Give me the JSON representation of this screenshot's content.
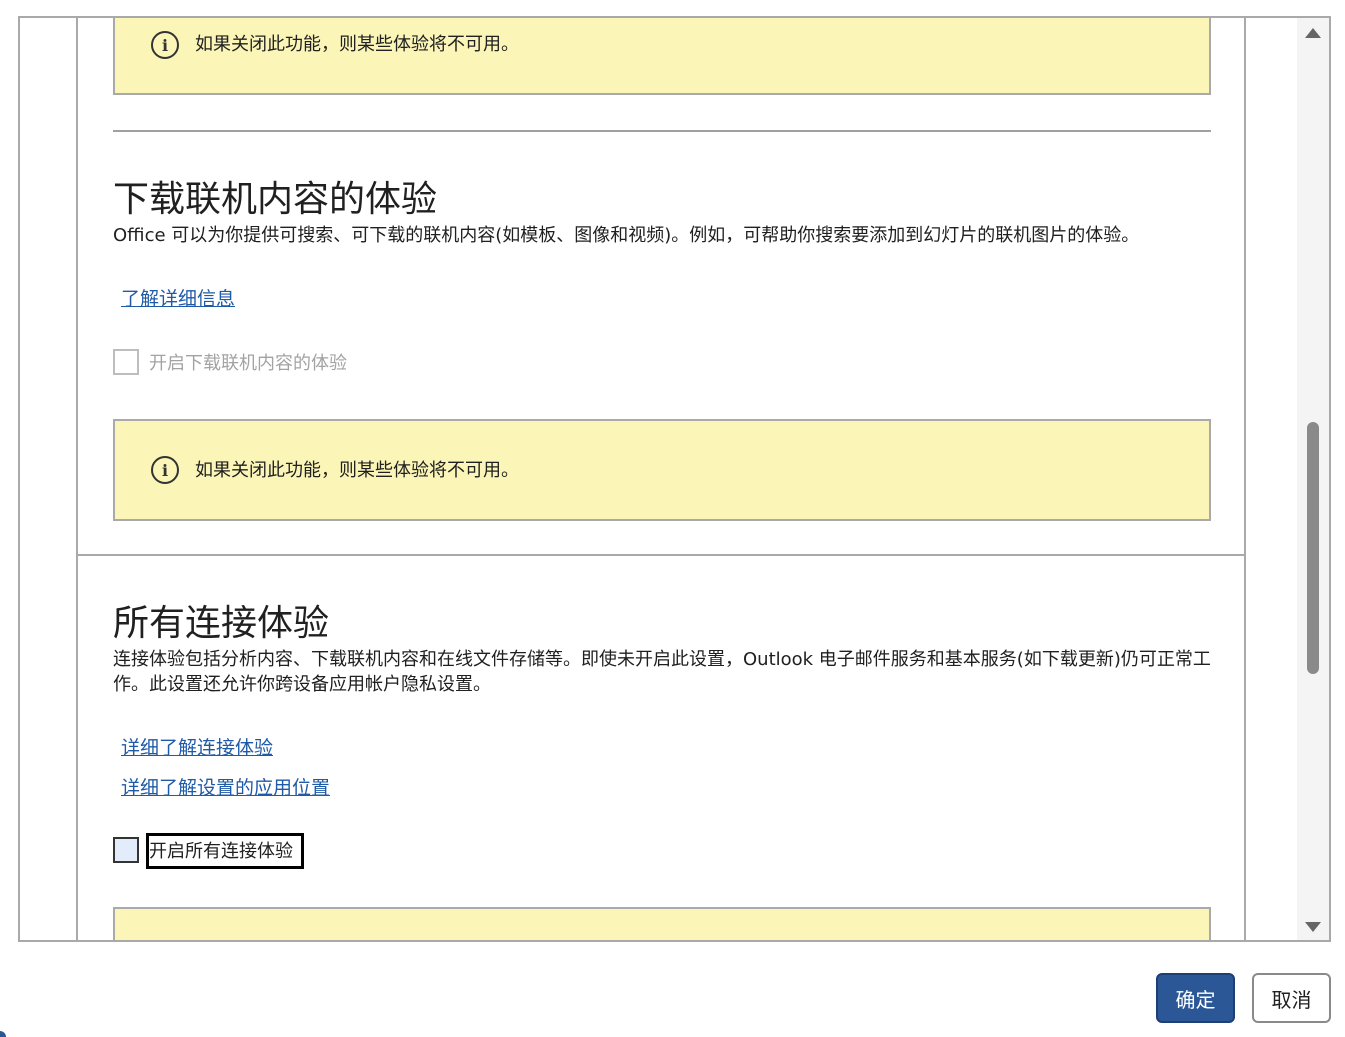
{
  "notice_text": "如果关闭此功能，则某些体验将不可用。",
  "download_section": {
    "title": "下载联机内容的体验",
    "description": "Office 可以为你提供可搜索、可下载的联机内容(如模板、图像和视频)。例如，可帮助你搜索要添加到幻灯片的联机图片的体验。",
    "link": "了解详细信息",
    "checkbox_label": "开启下载联机内容的体验",
    "checkbox_checked": false,
    "checkbox_enabled": false
  },
  "connected_section": {
    "title": "所有连接体验",
    "description": "连接体验包括分析内容、下载联机内容和在线文件存储等。即使未开启此设置，Outlook 电子邮件服务和基本服务(如下载更新)仍可正常工作。此设置还允许你跨设备应用帐户隐私设置。",
    "link1": "详细了解连接体验",
    "link2": "详细了解设置的应用位置",
    "checkbox_label": "开启所有连接体验",
    "checkbox_checked": false
  },
  "buttons": {
    "ok": "确定",
    "cancel": "取消"
  },
  "colors": {
    "notice_bg": "#fbf6b8",
    "link": "#1f5aa8",
    "primary_button": "#2b5797"
  }
}
